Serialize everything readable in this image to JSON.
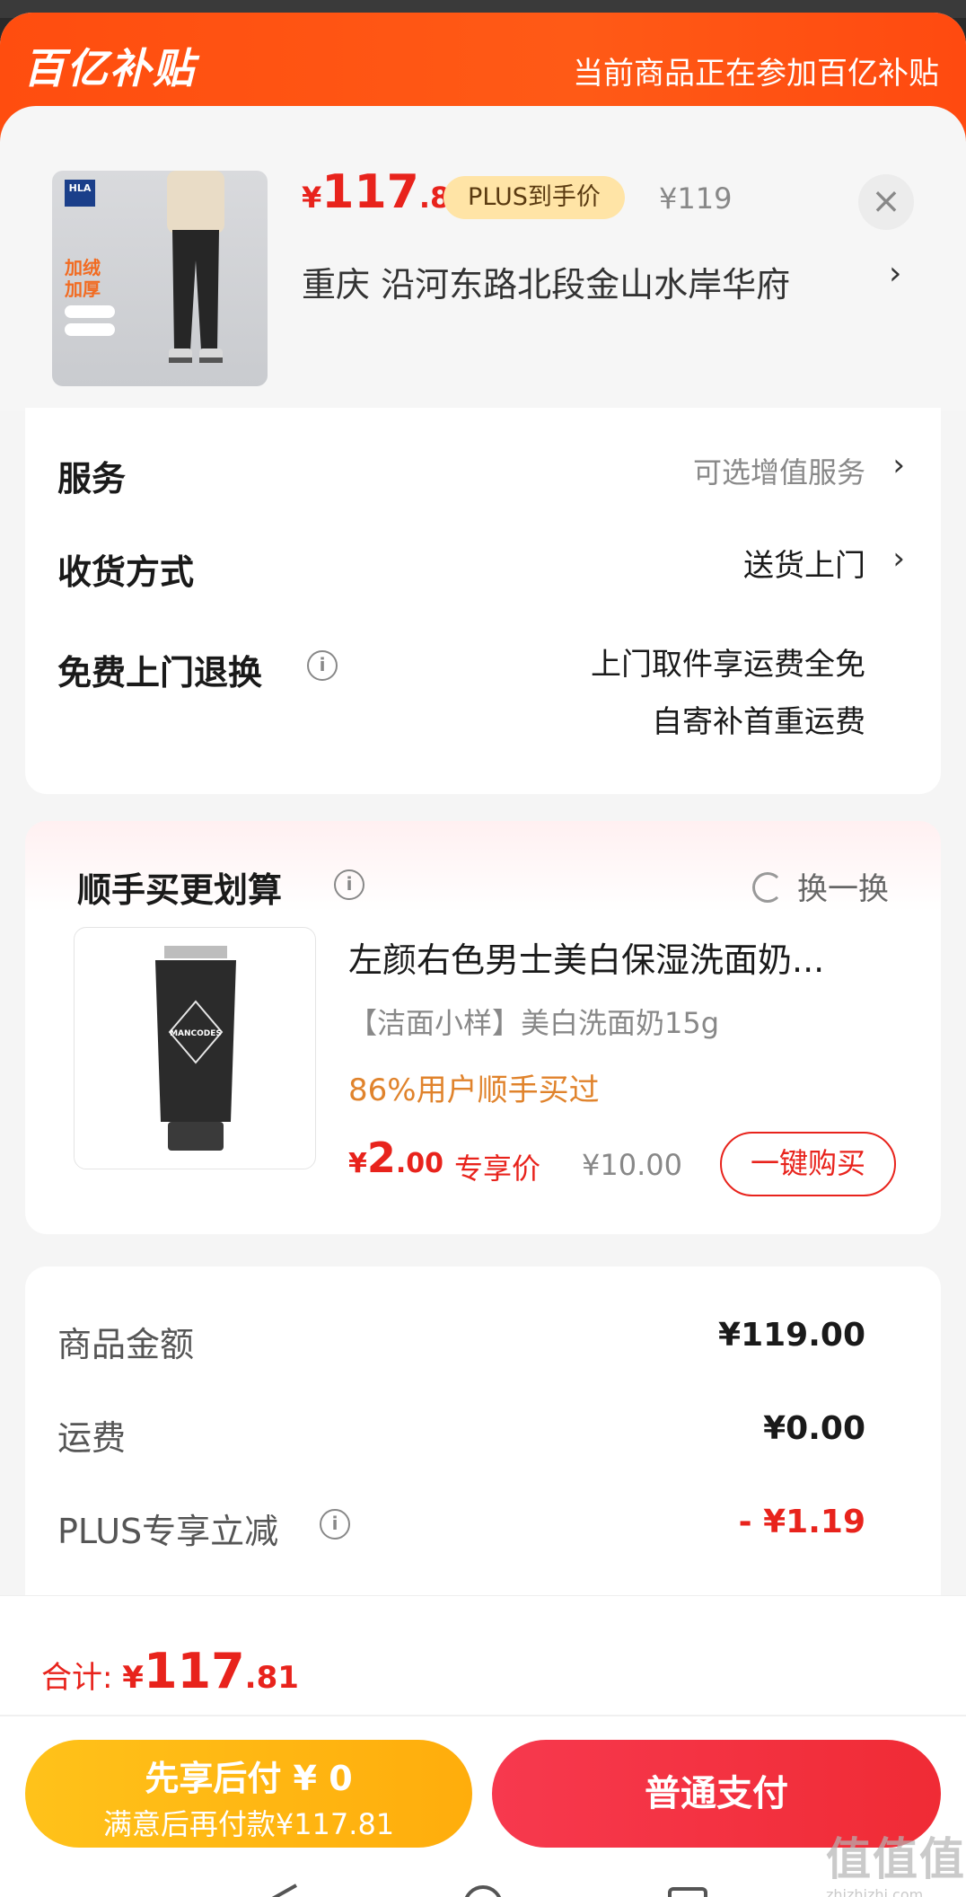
{
  "banner": {
    "logo": "百亿补贴",
    "tip": "当前商品正在参加百亿补贴"
  },
  "product": {
    "price_symbol": "¥",
    "price_int": "117",
    "price_dec": ".81",
    "plus_tag": "PLUS到手价",
    "original_price": "¥119",
    "close_icon": "×",
    "address": "重庆  沿河东路北段金山水岸华府",
    "address_arrow": "›",
    "thumb": {
      "brand": "HLA",
      "text_line1": "加绒",
      "text_line2": "加厚"
    }
  },
  "service": {
    "label": "服务",
    "value": "可选增值服务"
  },
  "delivery": {
    "label": "收货方式",
    "value": "送货上门"
  },
  "return": {
    "label": "免费上门退换",
    "info_icon": "i",
    "value_line1": "上门取件享运费全免",
    "value_line2": "自寄补首重运费"
  },
  "addon": {
    "title": "顺手买更划算",
    "info_icon": "i",
    "swap_label": "换一换",
    "name": "左颜右色男士美白保湿洗面奶...",
    "sub": "【洁面小样】美白洗面奶15g",
    "social": "86%用户顺手买过",
    "price_symbol": "¥",
    "price_int": "2",
    "price_dec": ".00",
    "price_tag": "专享价",
    "original_price": "¥10.00",
    "buy_label": "一键购买",
    "tube_brand": "MANCODES"
  },
  "summary": {
    "rows": [
      {
        "label": "商品金额",
        "value": "¥119.00"
      },
      {
        "label": "运费",
        "value": "¥0.00"
      },
      {
        "label": "PLUS专享立减",
        "value": "- ¥1.19"
      }
    ]
  },
  "bottom": {
    "total_label": "合计: ",
    "total_symbol": "¥",
    "total_int": "117",
    "total_dec": ".81",
    "later_main": "先享后付 ¥ 0",
    "later_sub": "满意后再付款¥117.81",
    "pay_label": "普通支付"
  },
  "watermark": {
    "big": "值值值",
    "small": "zhizhizhi.com"
  },
  "colors": {
    "brand_orange": "#ff4d0f",
    "price_red": "#e8231c",
    "plus_gold": "#ffe4a6",
    "later_yellow": "#ffb512",
    "pay_red": "#f02b35"
  }
}
